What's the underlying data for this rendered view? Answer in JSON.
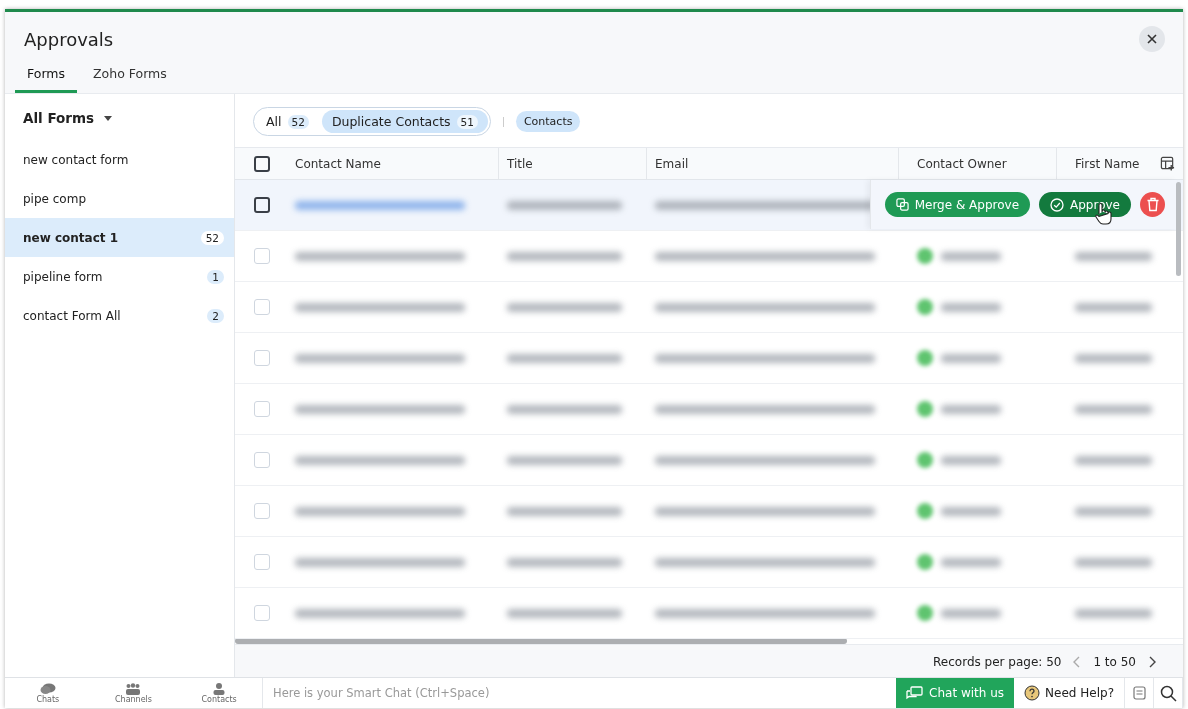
{
  "window": {
    "title": "Approvals"
  },
  "tabs": [
    {
      "label": "Forms",
      "selected": true
    },
    {
      "label": "Zoho Forms",
      "selected": false
    }
  ],
  "sidebar": {
    "heading": "All Forms",
    "items": [
      {
        "label": "new contact form",
        "selected": false
      },
      {
        "label": "pipe comp",
        "selected": false
      },
      {
        "label": "new contact 1",
        "count": "52",
        "selected": true
      },
      {
        "label": "pipeline form",
        "count": "1",
        "selected": false
      },
      {
        "label": "contact Form All",
        "count": "2",
        "selected": false
      }
    ]
  },
  "filters": [
    {
      "label": "All",
      "count": "52",
      "selected": false
    },
    {
      "label": "Duplicate Contacts",
      "count": "51",
      "selected": true
    }
  ],
  "module_chip": "Contacts",
  "table": {
    "select_all_checked": false,
    "columns": [
      "Contact Name",
      "Title",
      "Email",
      "Contact Owner",
      "First Name"
    ],
    "rows": [
      {
        "checked": false,
        "hovered": true
      },
      {
        "checked": false,
        "hovered": false
      },
      {
        "checked": false,
        "hovered": false
      },
      {
        "checked": false,
        "hovered": false
      },
      {
        "checked": false,
        "hovered": false
      },
      {
        "checked": false,
        "hovered": false
      },
      {
        "checked": false,
        "hovered": false
      },
      {
        "checked": false,
        "hovered": false
      },
      {
        "checked": false,
        "hovered": false
      }
    ],
    "row_actions": [
      "Merge & Approve",
      "Approve"
    ]
  },
  "pagination": {
    "records_label": "Records per page: 50",
    "range": "1 to 50"
  },
  "bottom_bar": {
    "nav": [
      {
        "label": "Chats",
        "kind": "chats"
      },
      {
        "label": "Channels",
        "kind": "channels"
      },
      {
        "label": "Contacts",
        "kind": "contacts"
      }
    ],
    "chat_placeholder": "Here is your Smart Chat (Ctrl+Space)",
    "chat_button": "Chat with us",
    "help": "Need Help?"
  }
}
